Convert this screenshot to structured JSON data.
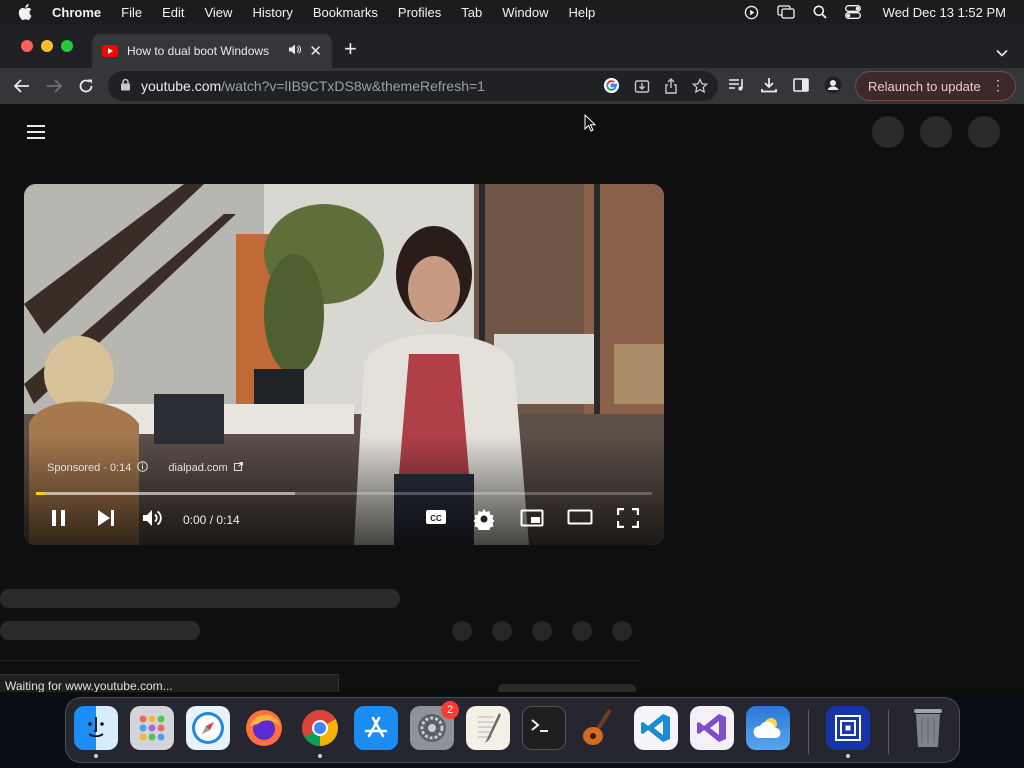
{
  "menubar": {
    "app_name": "Chrome",
    "items": [
      "File",
      "Edit",
      "View",
      "History",
      "Bookmarks",
      "Profiles",
      "Tab",
      "Window",
      "Help"
    ],
    "clock": "Wed Dec 13  1:52 PM"
  },
  "tab": {
    "title": "How to dual boot Windows",
    "close": "✕",
    "new_tab": "+"
  },
  "omnibox": {
    "host": "youtube.com",
    "path": "/watch?v=lIB9CTxDS8w&themeRefresh=1"
  },
  "relaunch": {
    "label": "Relaunch to update",
    "menu": "⋮"
  },
  "player": {
    "ad_label": "Sponsored · 0:14",
    "ad_domain": "dialpad.com",
    "time": "0:00 / 0:14",
    "progress_played": 0.015,
    "progress_buffered": 0.42,
    "accent": "#ffcc00"
  },
  "status": {
    "text": "Waiting for www.youtube.com..."
  },
  "dock": {
    "items": [
      {
        "name": "finder-icon",
        "running": true
      },
      {
        "name": "launchpad-icon",
        "running": false
      },
      {
        "name": "safari-icon",
        "running": false
      },
      {
        "name": "firefox-icon",
        "running": false
      },
      {
        "name": "chrome-icon",
        "running": true
      },
      {
        "name": "app-store-icon",
        "running": false
      },
      {
        "name": "system-settings-icon",
        "running": false,
        "badge": "2"
      },
      {
        "name": "textedit-icon",
        "running": false
      },
      {
        "name": "terminal-icon",
        "running": false
      },
      {
        "name": "garageband-icon",
        "running": false
      },
      {
        "name": "vscode-icon",
        "running": false
      },
      {
        "name": "visual-studio-icon",
        "running": false
      },
      {
        "name": "weather-icon",
        "running": false
      },
      {
        "name": "screen-sharing-icon",
        "running": true
      },
      {
        "name": "trash-icon",
        "running": false
      }
    ]
  }
}
